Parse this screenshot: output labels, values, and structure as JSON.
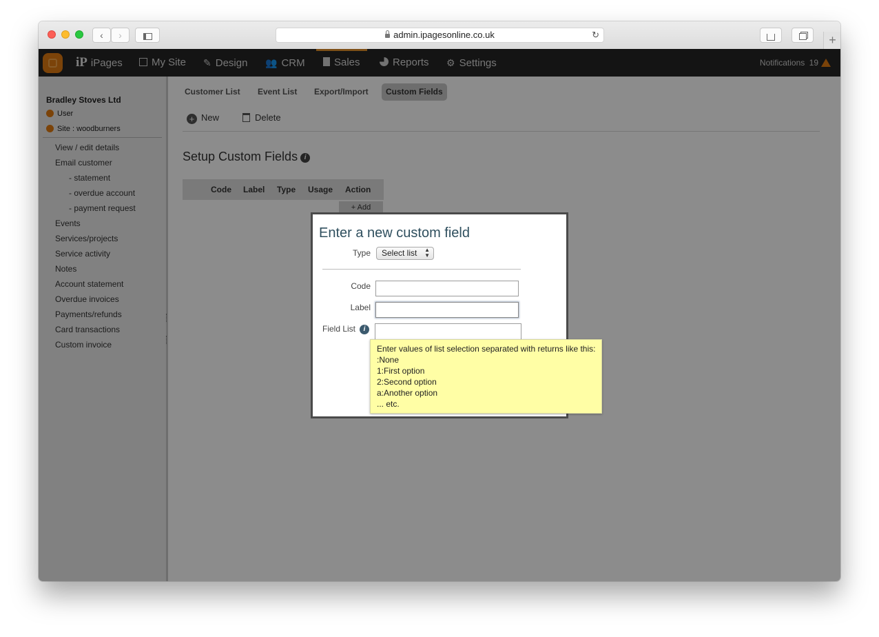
{
  "browser": {
    "url": "admin.ipagesonline.co.uk",
    "back_glyph": "‹",
    "forward_glyph": "›",
    "reload_glyph": "↻",
    "new_tab_glyph": "+"
  },
  "appnav": {
    "brand": "iPages",
    "brand_mark": "iP",
    "items": [
      {
        "label": "My Site",
        "icon": "edit-icon"
      },
      {
        "label": "Design",
        "icon": "design-icon"
      },
      {
        "label": "CRM",
        "icon": "people-icon"
      },
      {
        "label": "Sales",
        "icon": "clipboard-icon"
      },
      {
        "label": "Reports",
        "icon": "chart-icon"
      },
      {
        "label": "Settings",
        "icon": "gear-icon"
      }
    ],
    "notifications_label": "Notifications",
    "notifications_count": "19"
  },
  "sidebar": {
    "company": "Bradley Stoves Ltd",
    "user_label": "User",
    "site_label": "Site : woodburners",
    "items": [
      "View / edit details",
      "Email customer",
      "- statement",
      "- overdue account",
      "- payment request",
      "Events",
      "Services/projects",
      "Service activity",
      "Notes",
      "Account statement",
      "Overdue invoices",
      "Payments/refunds",
      "Card transactions",
      "Custom invoice"
    ]
  },
  "subtabs": [
    "Customer List",
    "Event List",
    "Export/Import",
    "Custom Fields"
  ],
  "toolbar": {
    "new_label": "New",
    "delete_label": "Delete"
  },
  "page": {
    "title": "Setup Custom Fields",
    "columns": [
      "Code",
      "Label",
      "Type",
      "Usage",
      "Action"
    ],
    "add_label": "+ Add"
  },
  "modal": {
    "title": "Enter a new custom field",
    "type_label": "Type",
    "type_value": "Select list",
    "code_label": "Code",
    "label_label": "Label",
    "fieldlist_label": "Field List",
    "code_value": "",
    "label_value": "",
    "tooltip_lines": [
      "Enter values of list selection separated with returns like this:",
      ":None",
      "1:First option",
      "2:Second option",
      "a:Another option",
      "... etc."
    ]
  },
  "colors": {
    "accent": "#e4902a",
    "appbar": "#252525",
    "tooltip": "#fffea5"
  }
}
